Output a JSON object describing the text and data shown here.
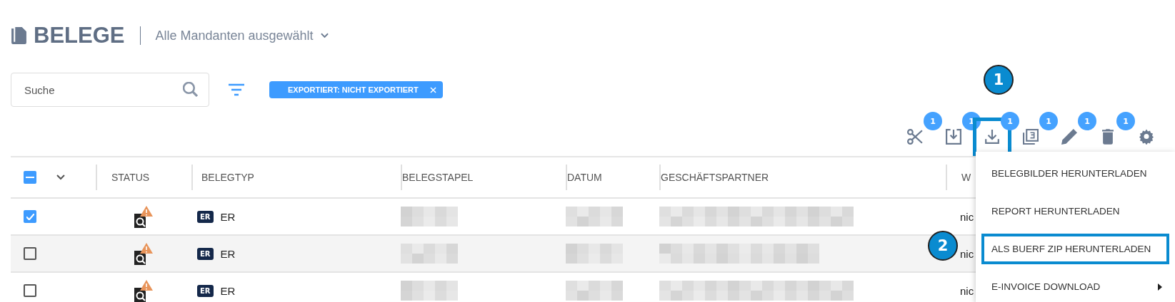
{
  "header": {
    "title": "BELEGE",
    "client_selector": "Alle Mandanten ausgewählt"
  },
  "search": {
    "placeholder": "Suche"
  },
  "filter_chips": [
    {
      "label": "EXPORTIERT: NICHT EXPORTIERT"
    }
  ],
  "toolbar": [
    {
      "kind": "scissors",
      "badge": "1",
      "highlighted": false
    },
    {
      "kind": "export",
      "badge": "1",
      "highlighted": false
    },
    {
      "kind": "download",
      "badge": "1",
      "highlighted": true
    },
    {
      "kind": "copies",
      "badge": "1",
      "highlighted": false
    },
    {
      "kind": "edit",
      "badge": "1",
      "highlighted": false
    },
    {
      "kind": "delete",
      "badge": "1",
      "highlighted": false
    },
    {
      "kind": "settings",
      "highlighted": false
    }
  ],
  "callouts": [
    "1",
    "2"
  ],
  "table": {
    "select_all_indeterminate": true,
    "columns": [
      "STATUS",
      "BELEGTYP",
      "BELEGSTAPEL",
      "DATUM",
      "GESCHÄFTSPARTNER",
      "W"
    ],
    "rows": [
      {
        "checked": true,
        "type_badge": "ER",
        "type": "ER",
        "column_6": "nic"
      },
      {
        "checked": false,
        "type_badge": "ER",
        "type": "ER",
        "column_6": "nic"
      },
      {
        "checked": false,
        "type_badge": "ER",
        "type": "ER",
        "column_6": "nic"
      }
    ]
  },
  "menu": {
    "items": [
      {
        "label": "BELEGBILDER HERUNTERLADEN",
        "highlighted": false,
        "submenu": false
      },
      {
        "label": "REPORT HERUNTERLADEN",
        "highlighted": false,
        "submenu": false
      },
      {
        "label": "ALS BUERF ZIP HERUNTERLADEN",
        "highlighted": true,
        "submenu": false
      },
      {
        "label": "E-INVOICE DOWNLOAD",
        "highlighted": false,
        "submenu": true
      }
    ]
  }
}
